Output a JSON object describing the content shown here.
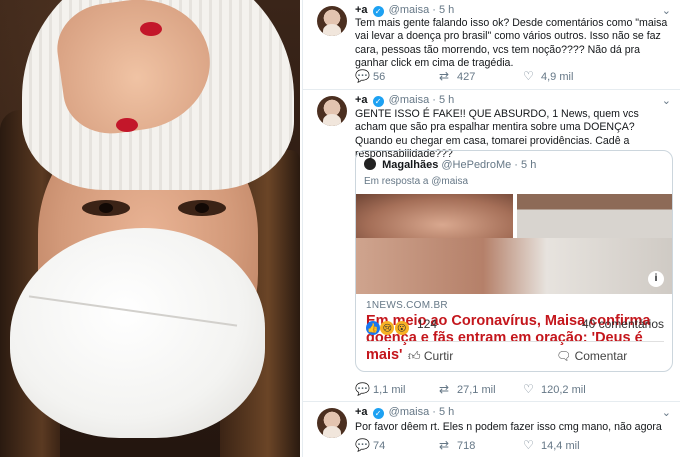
{
  "tweet1": {
    "display_name": "+a",
    "handle": "@maisa",
    "time": "5 h",
    "text": "Tem mais gente falando isso ok? Desde comentários como \"maisa vai levar a doença pro brasil\" como vários outros. Isso não se faz cara, pessoas tão morrendo, vcs tem noção???? Não dá pra ganhar click em cima de tragédia.",
    "replies": "56",
    "retweets": "427",
    "likes": "4,9 mil"
  },
  "tweet2": {
    "display_name": "+a",
    "handle": "@maisa",
    "time": "5 h",
    "text": "GENTE ISSO É FAKE!! QUE ABSURDO, 1 News, quem vcs acham que são pra espalhar mentira sobre uma DOENÇA? Quando eu chegar em casa, tomarei providências. Cadê a responsabilidade???",
    "replies": "1,1 mil",
    "retweets": "27,1 mil",
    "likes": "120,2 mil",
    "quote": {
      "display_name": "Magalhães",
      "handle": "@HePedroMe",
      "time": "5 h",
      "reply_to": "Em resposta a @maisa",
      "site": "1NEWS.COM.BR",
      "headline": "Em meio ao Coronavírus, Maisa confirma doença e fãs entram em oração: 'Deus é mais'",
      "reaction_count": "124",
      "comments": "40 comentários",
      "like_label": "Curtir",
      "comment_label": "Comentar"
    }
  },
  "tweet3": {
    "display_name": "+a",
    "handle": "@maisa",
    "time": "5 h",
    "text": "Por favor dêem rt. Eles n podem fazer isso cmg mano, não agora",
    "replies": "74",
    "retweets": "718",
    "likes": "14,4 mil"
  },
  "icons": {
    "reply": "reply-icon",
    "retweet": "retweet-icon",
    "like": "heart-icon",
    "more": "chevron-down-icon",
    "verified": "verified-badge-icon"
  },
  "colors": {
    "accent": "#1da1f2",
    "headline": "#c4161c",
    "muted": "#657786"
  }
}
